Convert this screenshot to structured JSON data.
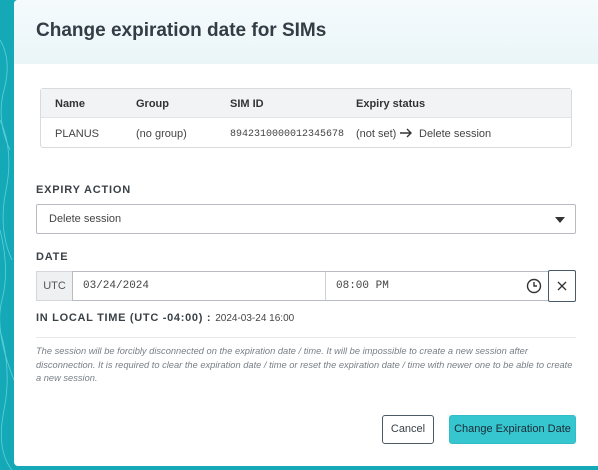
{
  "dialog": {
    "title": "Change expiration date for SIMs"
  },
  "sim_table": {
    "headers": [
      "Name",
      "Group",
      "SIM ID",
      "Expiry status"
    ],
    "rows": [
      {
        "name": "PLANUS",
        "group": "(no group)",
        "sim_id": "8942310000012345678",
        "expiry_from": "(not set)",
        "expiry_to": "Delete session"
      }
    ]
  },
  "expiry_action": {
    "label": "EXPIRY ACTION",
    "selected": "Delete session"
  },
  "date": {
    "label": "DATE",
    "timezone": "UTC",
    "date_value": "03/24/2024",
    "time_value": "08:00 PM"
  },
  "local_time": {
    "label": "IN LOCAL TIME (UTC -04:00) :",
    "value": "2024-03-24 16:00"
  },
  "note": "The session will be forcibly disconnected on the expiration date / time. It will be impossible to create a new session after disconnection. It is required to clear the expiration date / time or reset the expiration date / time with newer one to be able to create a new session.",
  "buttons": {
    "cancel": "Cancel",
    "submit": "Change Expiration Date"
  },
  "colors": {
    "background": "#15a9b8",
    "primary_button": "#36c6d0"
  },
  "icons": {
    "arrow": "arrow-right-icon",
    "caret": "caret-down-icon",
    "clock": "clock-icon",
    "clear": "close-icon"
  }
}
